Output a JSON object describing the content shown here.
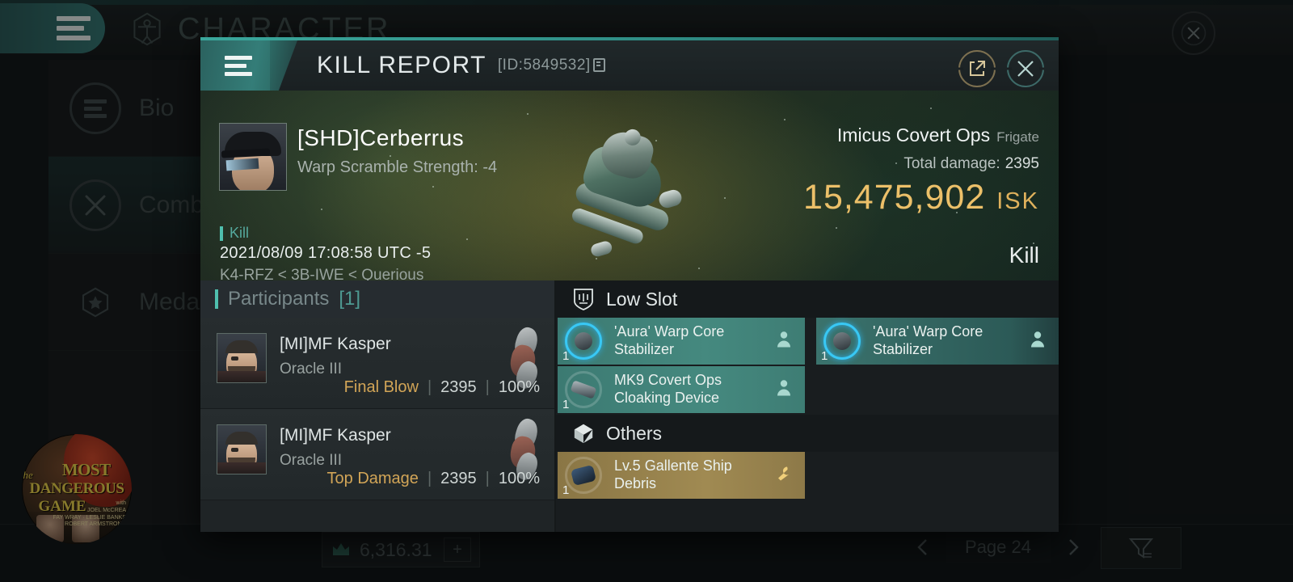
{
  "background": {
    "menu_icon": "hamburger-icon",
    "title": "CHARACTER",
    "title_icon": "vitruvian-man-icon",
    "close_icon": "close-icon",
    "nav": [
      {
        "label": "Bio",
        "icon": "list-icon",
        "active": false
      },
      {
        "label": "Combat",
        "icon": "crossed-swords-icon",
        "active": true
      },
      {
        "label": "Medal",
        "icon": "star-hexagon-icon",
        "active": false
      }
    ],
    "currency": {
      "icon": "crown-icon",
      "value": "6,316.31",
      "add_label": "+"
    },
    "pager": {
      "prev_icon": "chevron-left-icon",
      "label": "Page 24",
      "next_icon": "chevron-right-icon"
    },
    "filter_icon": "funnel-icon",
    "watermark": {
      "the": "The",
      "most": "MOST",
      "dangerous": "DANGEROUS",
      "game": "GAME",
      "cast_line1": "with",
      "cast_line2": "JOEL McCREA",
      "cast_line3": "FAY WRAY · LESLIE BANKS",
      "cast_line4": "ROBERT ARMSTRONG"
    }
  },
  "modal": {
    "menu_icon": "hamburger-icon",
    "title": "KILL REPORT",
    "id": "[ID:5849532]",
    "copy_icon": "copy-icon",
    "share_icon": "share-external-icon",
    "close_icon": "close-icon",
    "victim": {
      "portrait": "victim-portrait",
      "name": "[SHD]Cerberrus",
      "subtitle": "Warp Scramble Strength: -4",
      "result_tag": "Kill",
      "timestamp": "2021/08/09 17:08:58 UTC -5",
      "location": "K4-RFZ < 3B-IWE < Querious",
      "ship_name": "Imicus Covert Ops",
      "ship_class": "Frigate",
      "damage_label": "Total damage:",
      "damage_value": "2395",
      "isk_value": "15,475,902",
      "isk_currency": "ISK",
      "outcome": "Kill"
    },
    "participants": {
      "header_label": "Participants",
      "header_count": "[1]",
      "rows": [
        {
          "name": "[MI]MF Kasper",
          "ship": "Oracle III",
          "tag": "Final Blow",
          "damage": "2395",
          "percent": "100%"
        },
        {
          "name": "[MI]MF Kasper",
          "ship": "Oracle III",
          "tag": "Top Damage",
          "damage": "2395",
          "percent": "100%"
        }
      ]
    },
    "fitting": {
      "sections": [
        {
          "header": "Low Slot",
          "icon": "shield-slot-icon",
          "items": [
            {
              "name": "'Aura' Warp Core Stabilizer",
              "qty": "1",
              "style": "teal",
              "icon": "warp-core-stabilizer-icon",
              "badge": "person-icon",
              "column": 1
            },
            {
              "name": "'Aura' Warp Core Stabilizer",
              "qty": "1",
              "style": "teal",
              "icon": "warp-core-stabilizer-icon",
              "badge": "person-icon",
              "column": 2
            },
            {
              "name": "MK9 Covert Ops Cloaking Device",
              "qty": "1",
              "style": "teal",
              "icon": "cloaking-device-icon",
              "badge": "person-icon",
              "column": 1
            }
          ]
        },
        {
          "header": "Others",
          "icon": "cube-box-icon",
          "items": [
            {
              "name": "Lv.5 Gallente Ship Debris",
              "qty": "1",
              "style": "gold",
              "icon": "ship-debris-icon",
              "badge": "wrench-icon",
              "column": 1
            }
          ]
        }
      ]
    }
  },
  "colors": {
    "accent_teal": "#3aa79c",
    "isk_gold": "#ecc069",
    "item_teal": "#45897f",
    "item_gold": "#a08a52",
    "tag_gold": "#d2a557"
  }
}
